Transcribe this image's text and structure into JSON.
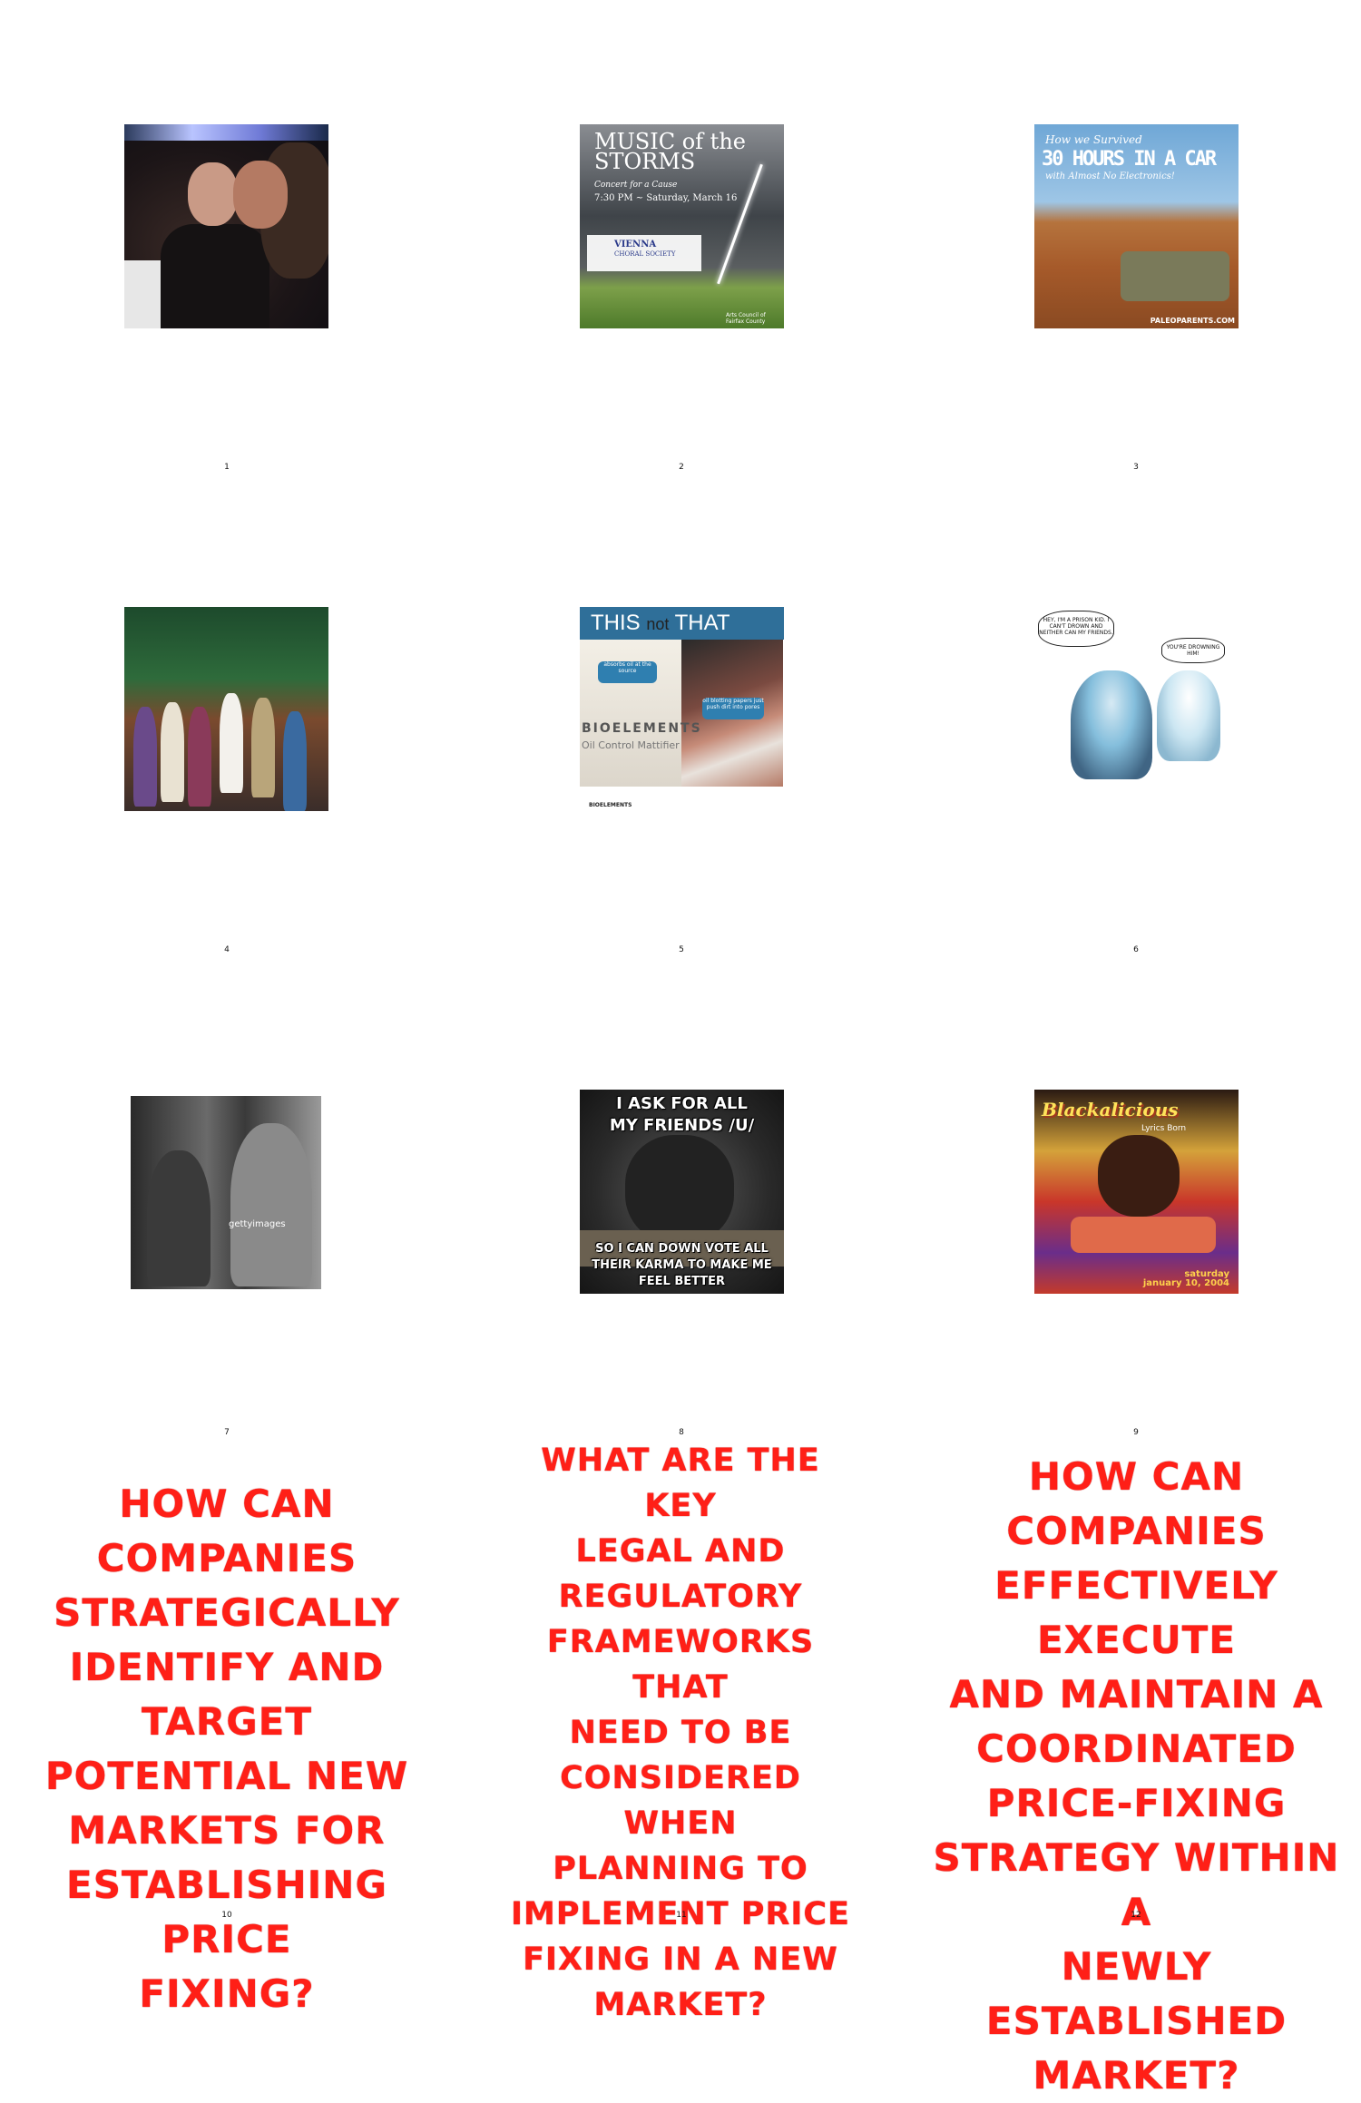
{
  "panels": [
    {
      "number": "1",
      "kind": "photo",
      "subject": "couple kissing"
    },
    {
      "number": "2",
      "kind": "poster",
      "title_line1": "MUSIC of the",
      "title_line2": "STORMS",
      "subtitle": "Concert for a Cause",
      "date_line": "7:30 PM ~ Saturday, March 16",
      "org_line1": "VIENNA",
      "org_line2": "CHORAL SOCIETY",
      "footer": "Arts Council of Fairfax County"
    },
    {
      "number": "3",
      "kind": "photo",
      "line1": "How we Survived",
      "line2": "30 HOURS IN A CAR",
      "line3": "with Almost No Electronics!",
      "url": "PALEOPARENTS.COM"
    },
    {
      "number": "4",
      "kind": "photo",
      "subject": "group of people at nativity scene"
    },
    {
      "number": "5",
      "kind": "ad",
      "header_this": "THIS",
      "header_not": "not",
      "header_that": "THAT",
      "bubble_left": "absorbs oil at the source",
      "bubble_right": "oil blotting papers just push dirt into pores",
      "brand": "BIOELEMENTS",
      "product": "Oil Control Mattifier",
      "footer_brand": "BIOELEMENTS"
    },
    {
      "number": "6",
      "kind": "comic",
      "speech_left": "HEY, I'M A PRISON KID. I CAN'T DROWN AND NEITHER CAN MY FRIENDS.",
      "speech_right": "YOU'RE DROWNING HIM!"
    },
    {
      "number": "7",
      "kind": "photo",
      "subject": "vintage black and white couple",
      "watermark": "gettyimages"
    },
    {
      "number": "8",
      "kind": "meme",
      "top_text": "I ASK FOR ALL MY FRIENDS /U/",
      "bottom_text": "SO I CAN DOWN VOTE ALL THEIR KARMA TO MAKE ME FEEL BETTER"
    },
    {
      "number": "9",
      "kind": "poster",
      "title": "Blackalicious",
      "subtitle": "Lyrics Born",
      "date_line1": "saturday",
      "date_line2": "january 10, 2004"
    },
    {
      "number": "10",
      "kind": "text",
      "lines": [
        "HOW CAN COMPANIES",
        "STRATEGICALLY",
        "IDENTIFY AND TARGET",
        "POTENTIAL NEW",
        "MARKETS FOR",
        "ESTABLISHING PRICE",
        "FIXING?"
      ]
    },
    {
      "number": "11",
      "kind": "text",
      "lines": [
        "WHAT ARE THE KEY",
        "LEGAL AND",
        "REGULATORY",
        "FRAMEWORKS THAT",
        "NEED TO BE",
        "CONSIDERED WHEN",
        "PLANNING TO",
        "IMPLEMENT PRICE",
        "FIXING IN A NEW",
        "MARKET?"
      ]
    },
    {
      "number": "12",
      "kind": "text",
      "lines": [
        "HOW CAN COMPANIES",
        "EFFECTIVELY EXECUTE",
        "AND MAINTAIN A",
        "COORDINATED",
        "PRICE-FIXING",
        "STRATEGY WITHIN A",
        "NEWLY ESTABLISHED",
        "MARKET?"
      ]
    }
  ],
  "colors": {
    "text_red": "#ff1f17",
    "background": "#ffffff"
  }
}
